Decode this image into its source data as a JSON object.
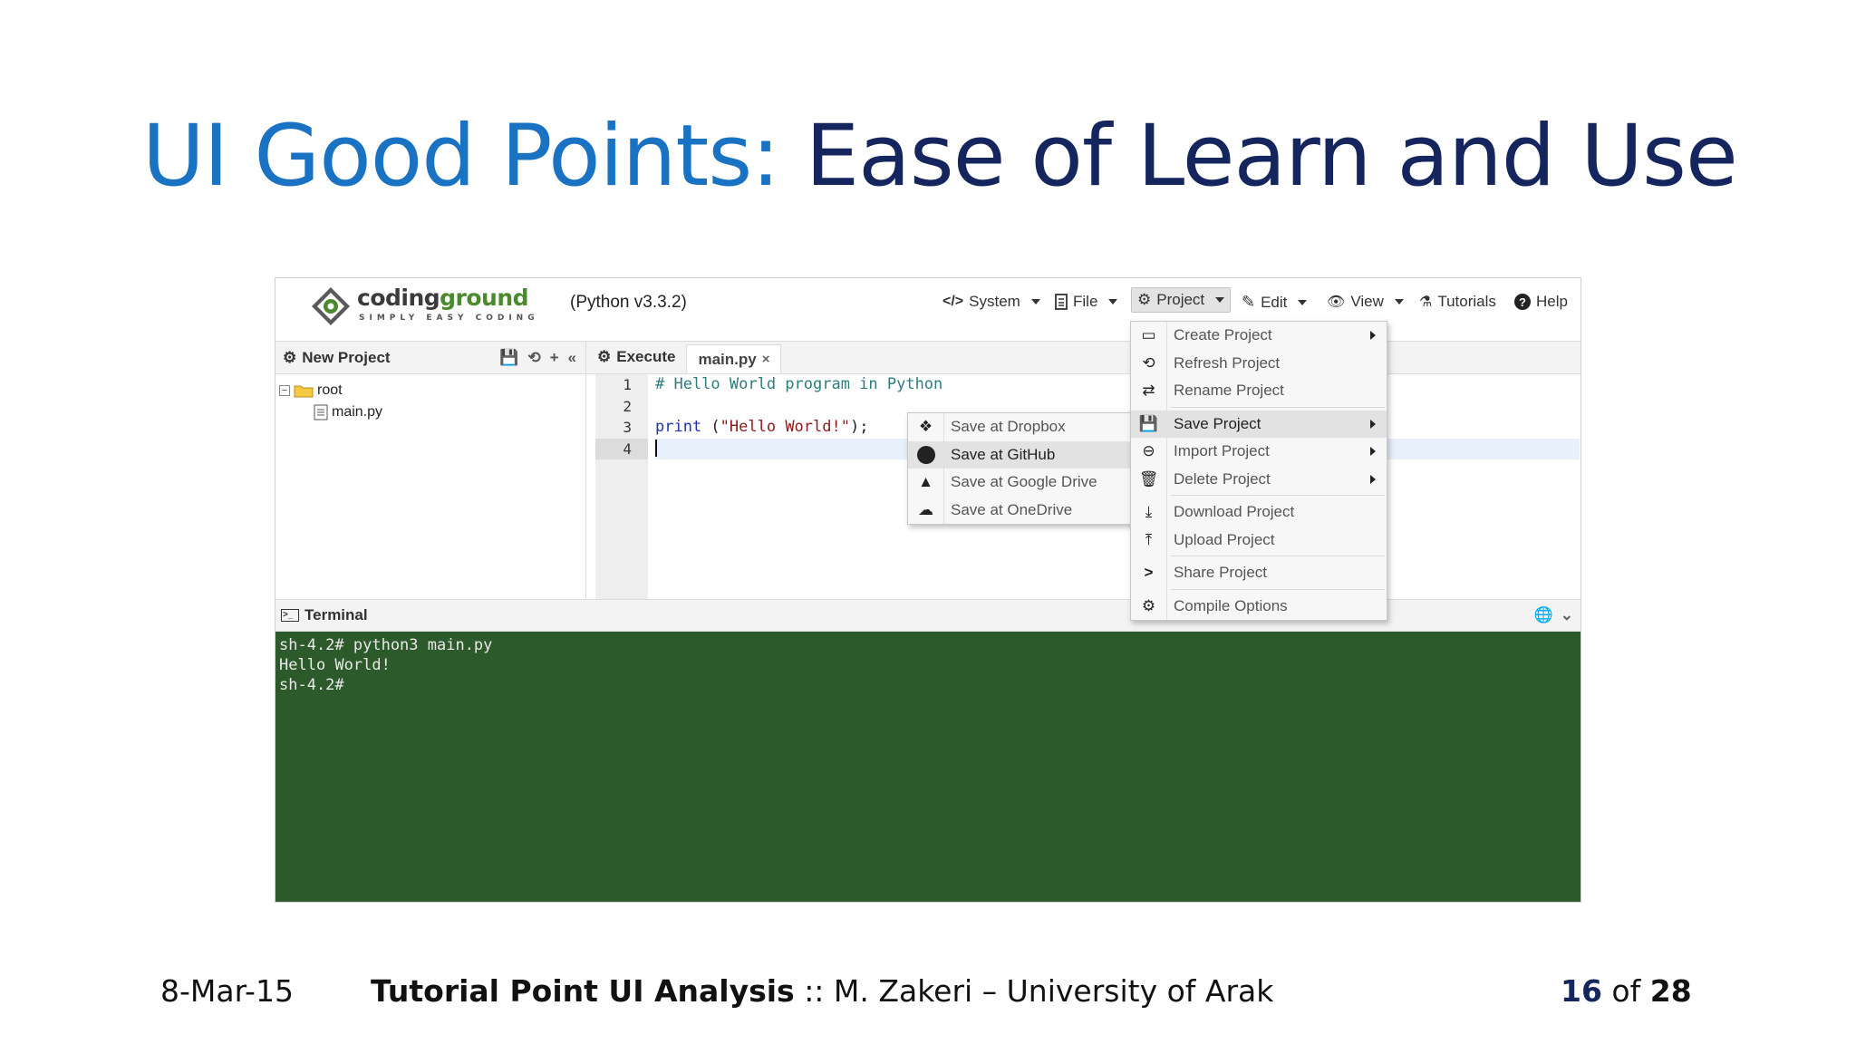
{
  "slide": {
    "title_highlight": "UI Good Points:",
    "title_rest": "Ease of Learn and Use",
    "footer_date": "8-Mar-15",
    "footer_course": "Tutorial Point  UI Analysis",
    "footer_sep": " :: ",
    "footer_author": "M. Zakeri – University of Arak",
    "page_current": "16",
    "page_of": " of ",
    "page_total": "28"
  },
  "app": {
    "logo_name_1": "coding",
    "logo_name_2": "ground",
    "logo_tagline": "SIMPLY EASY CODING",
    "version": "(Python v3.3.2)",
    "menu": {
      "system": "System",
      "file": "File",
      "project": "Project",
      "edit": "Edit",
      "view": "View",
      "tutorials": "Tutorials",
      "help": "Help"
    }
  },
  "project_panel": {
    "header": "New Project",
    "tree": [
      {
        "label": "root",
        "type": "folder"
      },
      {
        "label": "main.py",
        "type": "file"
      }
    ]
  },
  "editor": {
    "execute_label": "Execute",
    "tab_label": "main.py",
    "tab_close": "×",
    "line_numbers": [
      "1",
      "2",
      "3",
      "4"
    ],
    "lines": {
      "line1_comment": "# Hello World program in Python",
      "line3_kw": "print",
      "line3_open": " (",
      "line3_str": "\"Hello World!\"",
      "line3_close": ");"
    }
  },
  "terminal": {
    "header": "Terminal",
    "lines": [
      "sh-4.2# python3 main.py",
      "Hello World!",
      "sh-4.2#"
    ]
  },
  "project_menu": {
    "items": [
      "Create Project",
      "Refresh Project",
      "Rename Project",
      "Save Project",
      "Import Project",
      "Delete Project",
      "Download Project",
      "Upload Project",
      "Share Project",
      "Compile Options"
    ],
    "highlighted": "Save Project"
  },
  "save_submenu": {
    "items": [
      "Save at Dropbox",
      "Save at GitHub",
      "Save at Google Drive",
      "Save at OneDrive"
    ],
    "highlighted": "Save at GitHub"
  },
  "colors": {
    "title_blue": "#1a73c2",
    "title_navy": "#15255e",
    "terminal_bg": "#2c5a2b",
    "logo_green": "#4a8a2d"
  }
}
